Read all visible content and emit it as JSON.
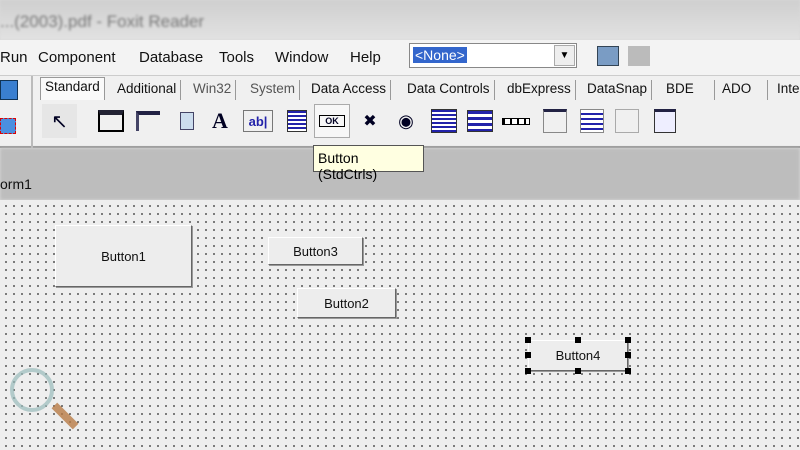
{
  "window_title": "...(2003).pdf - Foxit Reader",
  "menu": [
    "Run",
    "Component",
    "Database",
    "Tools",
    "Window",
    "Help"
  ],
  "combo": {
    "value": "<None>"
  },
  "palette_tabs": [
    "Standard",
    "Additional",
    "Win32",
    "System",
    "Data Access",
    "Data Controls",
    "dbExpress",
    "DataSnap",
    "BDE",
    "ADO",
    "Inte"
  ],
  "palette_icons": [
    "pointer-icon",
    "frames-icon",
    "mainmenu-icon",
    "popupmenu-icon",
    "label-icon",
    "edit-icon",
    "memo-icon",
    "button-icon",
    "checkbox-icon",
    "radiobutton-icon",
    "listbox-icon",
    "combobox-icon",
    "scrollbar-icon",
    "groupbox-icon",
    "radiogroup-icon",
    "panel-icon",
    "actionlist-icon"
  ],
  "tooltip": "Button (StdCtrls)",
  "form": {
    "caption": "orm1",
    "buttons": [
      "Button1",
      "Button3",
      "Button2",
      "Button4"
    ]
  },
  "glyphs": {
    "label": "A",
    "edit": "ab|",
    "button": "OK",
    "checkbox": "✖",
    "radio": "◉"
  }
}
